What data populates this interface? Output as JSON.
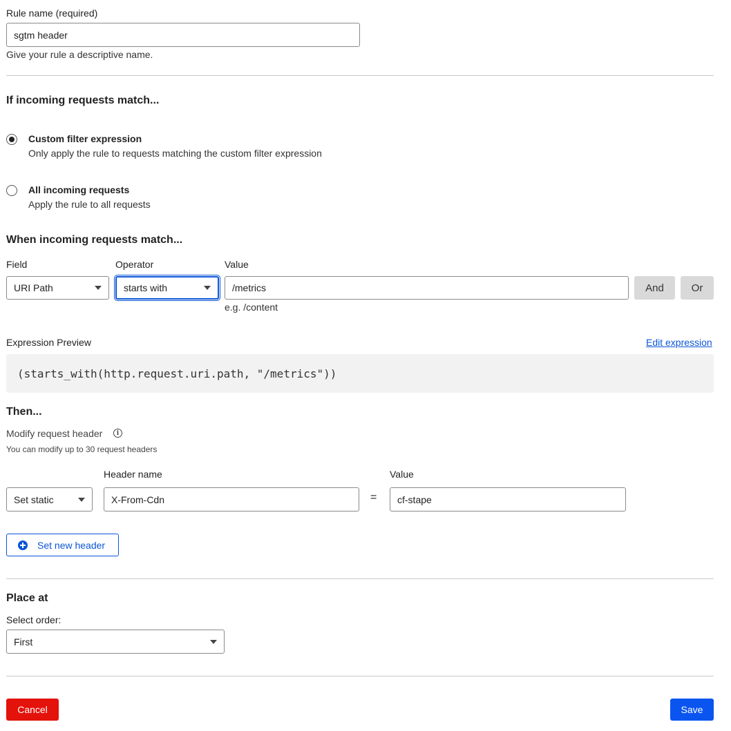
{
  "rule_name": {
    "label": "Rule name (required)",
    "value": "sgtm header",
    "help": "Give your rule a descriptive name."
  },
  "match_section": {
    "heading": "If incoming requests match...",
    "options": [
      {
        "title": "Custom filter expression",
        "description": "Only apply the rule to requests matching the custom filter expression",
        "checked": true
      },
      {
        "title": "All incoming requests",
        "description": "Apply the rule to all requests",
        "checked": false
      }
    ]
  },
  "when_section": {
    "heading": "When incoming requests match...",
    "field_label": "Field",
    "field_value": "URI Path",
    "operator_label": "Operator",
    "operator_value": "starts with",
    "value_label": "Value",
    "value_value": "/metrics",
    "value_help": "e.g. /content",
    "and_label": "And",
    "or_label": "Or"
  },
  "expression": {
    "label": "Expression Preview",
    "edit_link": "Edit expression",
    "code": "(starts_with(http.request.uri.path, \"/metrics\"))"
  },
  "then_section": {
    "heading": "Then...",
    "subheading": "Modify request header",
    "help": "You can modify up to 30 request headers",
    "action_value": "Set static",
    "header_name_label": "Header name",
    "header_name_value": "X-From-Cdn",
    "equals": "=",
    "value_label": "Value",
    "value_value": "cf-stape",
    "add_button": "Set new header"
  },
  "place_section": {
    "heading": "Place at",
    "order_label": "Select order:",
    "order_value": "First"
  },
  "footer": {
    "cancel": "Cancel",
    "save": "Save"
  },
  "colors": {
    "accent": "#0a55d6",
    "danger": "#e3120b",
    "primary": "#0a55f0"
  }
}
